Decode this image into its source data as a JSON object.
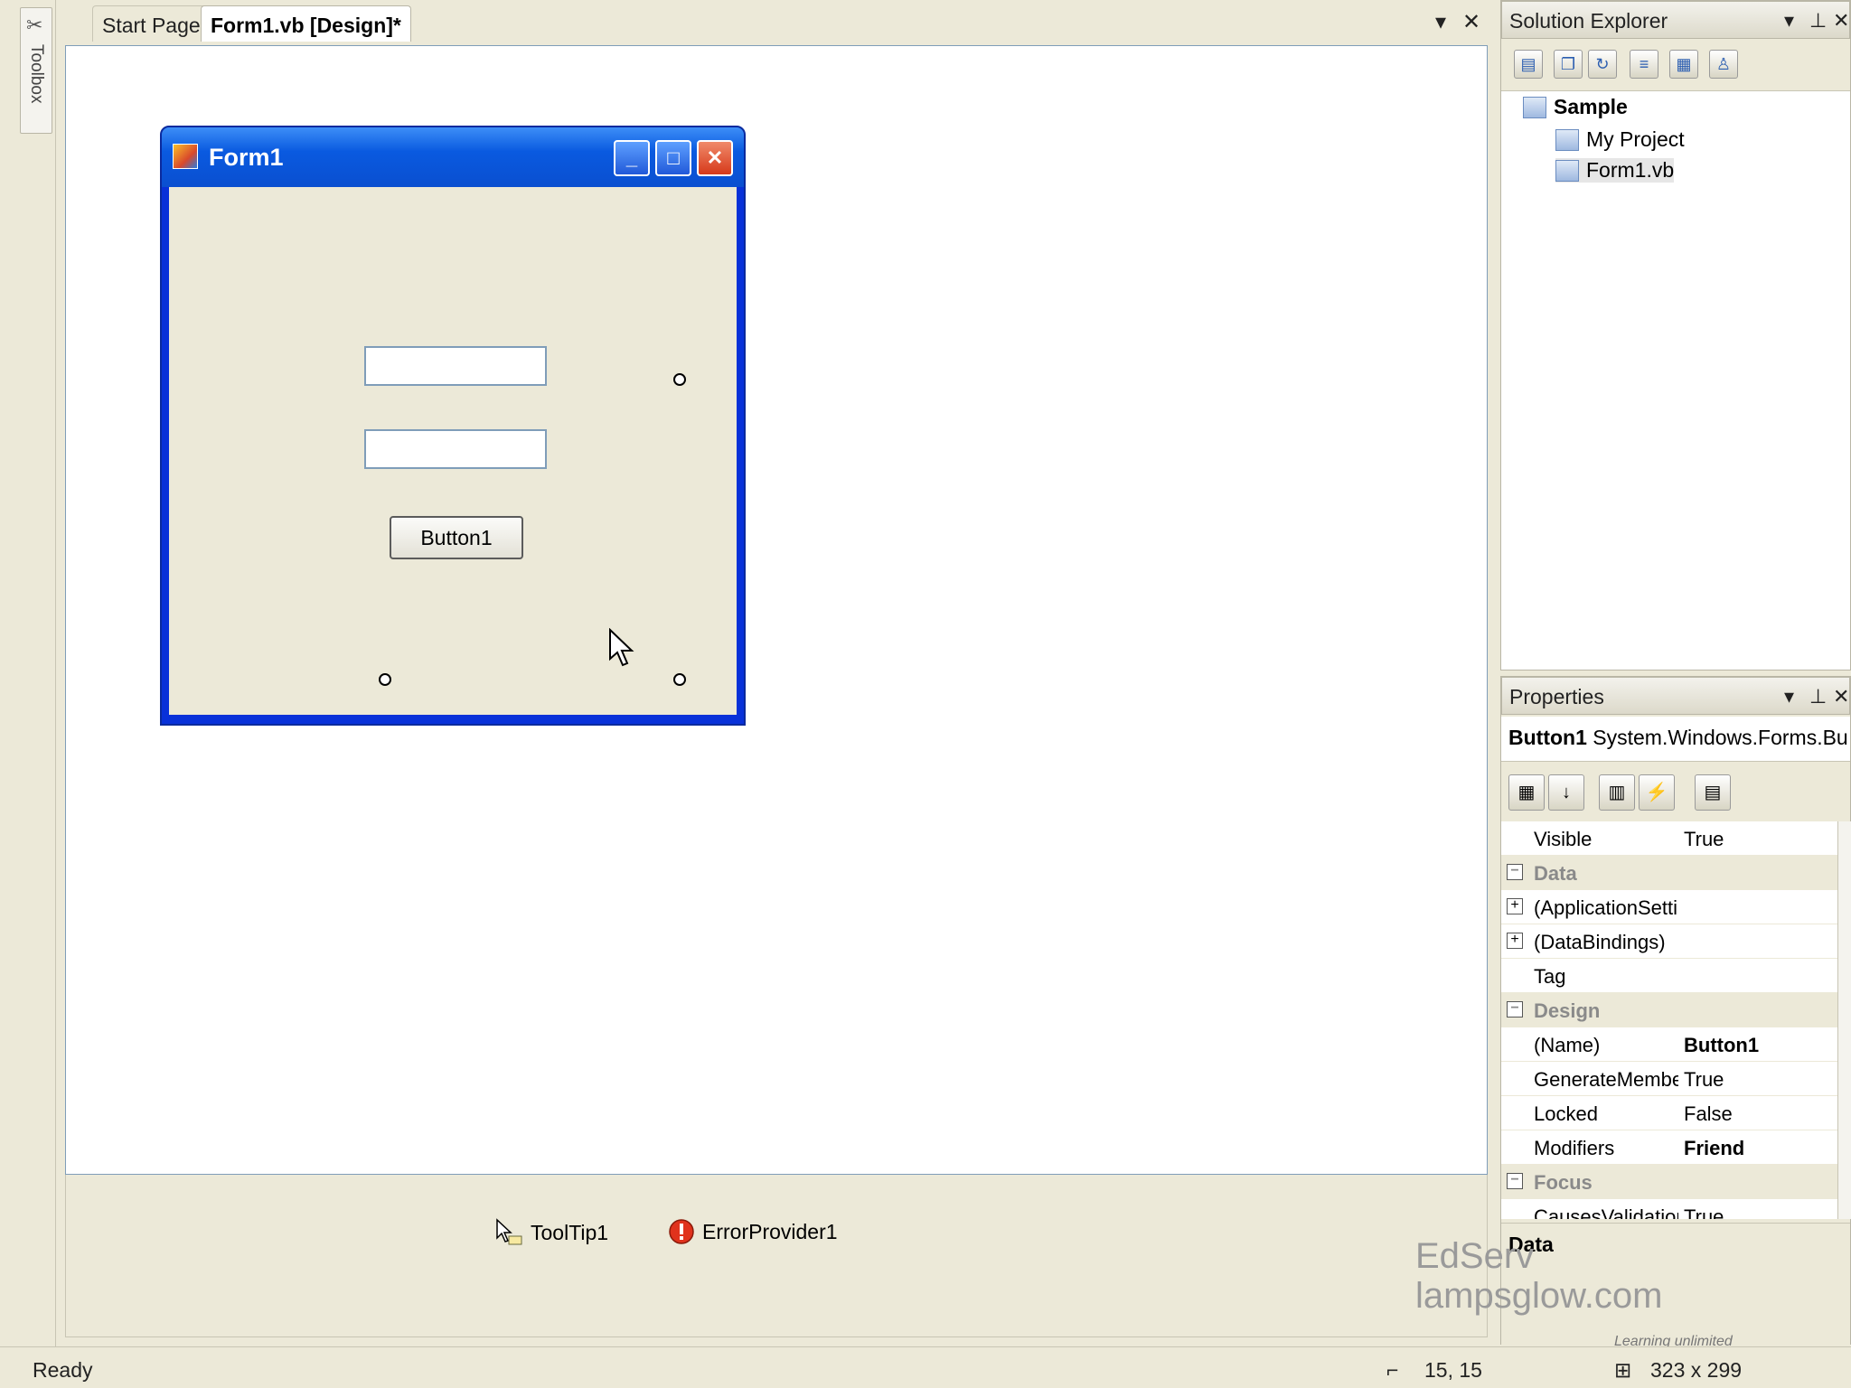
{
  "toolbox": {
    "label": "Toolbox"
  },
  "document": {
    "tabs": [
      {
        "label": "Start Page"
      },
      {
        "label": "Form1.vb [Design]*"
      }
    ],
    "dropdown_glyph": "▾",
    "close_glyph": "✕"
  },
  "form": {
    "title": "Form1",
    "minimize_glyph": "_",
    "maximize_glyph": "□",
    "close_glyph": "✕",
    "button_label": "Button1",
    "textbox1_value": "",
    "textbox2_value": ""
  },
  "tray": {
    "items": [
      {
        "label": "ToolTip1",
        "icon": "tooltip-icon"
      },
      {
        "label": "ErrorProvider1",
        "icon": "error-provider-icon"
      }
    ]
  },
  "solution_explorer": {
    "title": "Solution Explorer",
    "tree": [
      {
        "label": "Sample",
        "bold": true
      },
      {
        "label": "My Project"
      },
      {
        "label": "Form1.vb"
      }
    ]
  },
  "properties": {
    "title": "Properties",
    "selected_object": "Button1",
    "selected_type": "System.Windows.Forms.Bu",
    "rows": [
      {
        "name": "Visible",
        "value": "True"
      },
      {
        "name": "Data",
        "category": true
      },
      {
        "name": "(ApplicationSetti",
        "value": "",
        "expandable": true
      },
      {
        "name": "(DataBindings)",
        "value": "",
        "expandable": true
      },
      {
        "name": "Tag",
        "value": ""
      },
      {
        "name": "Design",
        "category": true
      },
      {
        "name": "(Name)",
        "value": "Button1",
        "bold": true
      },
      {
        "name": "GenerateMembe",
        "value": "True"
      },
      {
        "name": "Locked",
        "value": "False"
      },
      {
        "name": "Modifiers",
        "value": "Friend",
        "bold": true
      },
      {
        "name": "Focus",
        "category": true
      },
      {
        "name": "CausesValidatior",
        "value": "True"
      }
    ],
    "description_title": "Data"
  },
  "watermark": {
    "line1": "EdServ",
    "line2": "lampsglow.com",
    "tagline": "Learning unlimited"
  },
  "status_bar": {
    "ready": "Ready",
    "position": "15, 15",
    "size": "323 x 299"
  }
}
